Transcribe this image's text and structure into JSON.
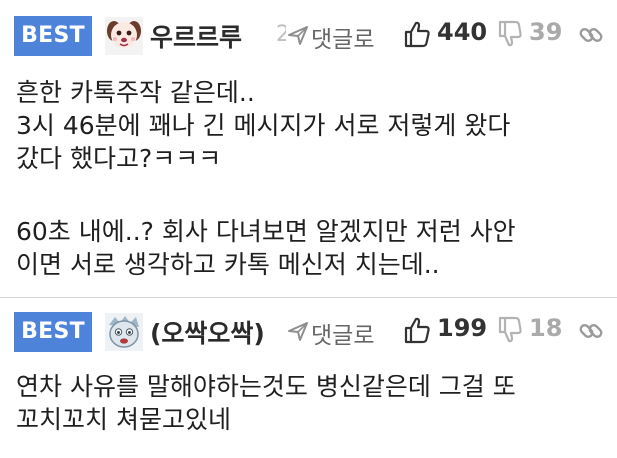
{
  "comments": [
    {
      "badge": "BEST",
      "username": "우르르루",
      "username_tail": "2",
      "reply_label": "댓글로",
      "likes": "440",
      "dislikes": "39",
      "avatar_icon": "puppy-avatar-icon",
      "body_lines": [
        "흔한 카톡주작 같은데..",
        "3시 46분에 꽤나 긴 메시지가 서로 저렇게 왔다",
        "갔다 했다고?ㅋㅋㅋ",
        "",
        "60초 내에..? 회사 다녀보면 알겠지만 저런 사안",
        "이면 서로 생각하고 카톡 메신저 치는데.."
      ]
    },
    {
      "badge": "BEST",
      "username": "(오싹오싹)",
      "reply_label": "댓글로",
      "likes": "199",
      "dislikes": "18",
      "avatar_icon": "cartoon-avatar-icon",
      "body_lines": [
        "연차 사유를 말해야하는것도 병신같은데 그걸 또",
        "꼬치꼬치 쳐묻고있네"
      ]
    }
  ],
  "colors": {
    "best_badge": "#4d84d9",
    "divider": "#d6d6d6",
    "muted_icon": "#9a9a9a"
  },
  "icons": {
    "reply": "send-arrow-icon",
    "like": "thumbs-up-icon",
    "dislike": "thumbs-down-icon",
    "link": "chain-link-icon"
  }
}
